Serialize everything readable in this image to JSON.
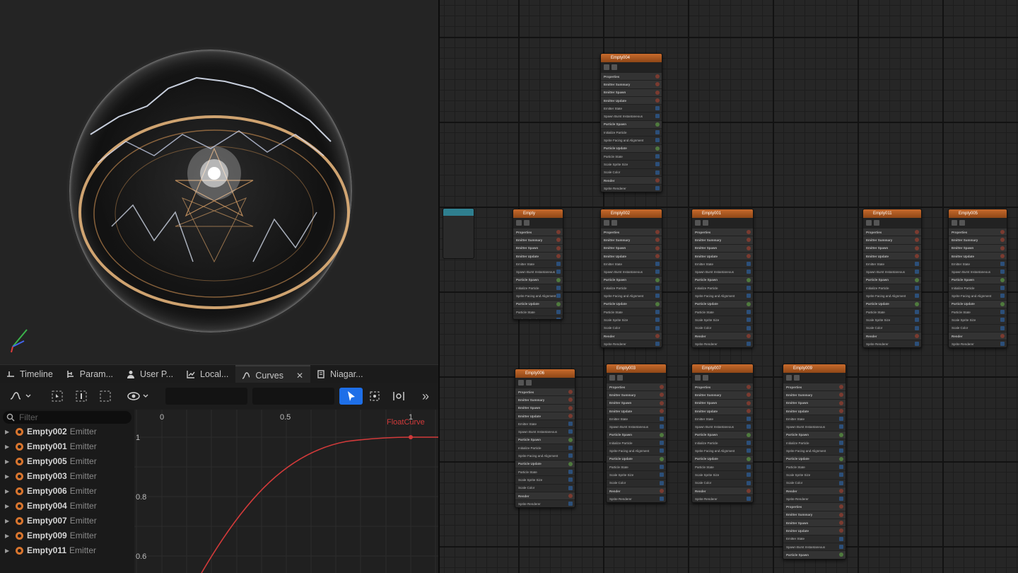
{
  "tabs": [
    {
      "label": "Timeline",
      "icon": "timeline-icon"
    },
    {
      "label": "Param...",
      "icon": "parameters-icon"
    },
    {
      "label": "User P...",
      "icon": "user-icon"
    },
    {
      "label": "Local...",
      "icon": "chart-icon"
    },
    {
      "label": "Curves",
      "icon": "curves-icon",
      "active": true
    },
    {
      "label": "Niagar...",
      "icon": "document-icon"
    }
  ],
  "curves": {
    "filter_placeholder": "Filter",
    "emitters": [
      {
        "name": "Empty002",
        "kind": "Emitter"
      },
      {
        "name": "Empty001",
        "kind": "Emitter"
      },
      {
        "name": "Empty005",
        "kind": "Emitter"
      },
      {
        "name": "Empty003",
        "kind": "Emitter"
      },
      {
        "name": "Empty006",
        "kind": "Emitter"
      },
      {
        "name": "Empty004",
        "kind": "Emitter"
      },
      {
        "name": "Empty007",
        "kind": "Emitter"
      },
      {
        "name": "Empty009",
        "kind": "Emitter"
      },
      {
        "name": "Empty011",
        "kind": "Emitter"
      }
    ],
    "x_ticks": [
      "0",
      "0.5",
      "1"
    ],
    "y_ticks": [
      "1",
      "0.8",
      "0.6"
    ],
    "curve_label": "FloatCurve",
    "curve_color": "#d23a3a"
  },
  "graph": {
    "nodes": [
      {
        "title": "Empty004"
      },
      {
        "title": "Empty"
      },
      {
        "title": "Empty002"
      },
      {
        "title": "Empty001"
      },
      {
        "title": "Empty011"
      },
      {
        "title": "Empty005"
      },
      {
        "title": "Empty006"
      },
      {
        "title": "Empty003"
      },
      {
        "title": "Empty007"
      },
      {
        "title": "Empty009"
      }
    ],
    "row_labels": [
      "Properties",
      "Emitter Summary",
      "Emitter Spawn",
      "Emitter Update",
      "Emitter State",
      "Spawn Burst Instantaneous",
      "Particle Spawn",
      "Initialize Particle",
      "Sprite Facing and Alignment",
      "Particle Update",
      "Particle State",
      "Scale Sprite Size",
      "Scale Color",
      "Render",
      "Sprite Renderer"
    ],
    "header_color": "#c86a2c"
  }
}
